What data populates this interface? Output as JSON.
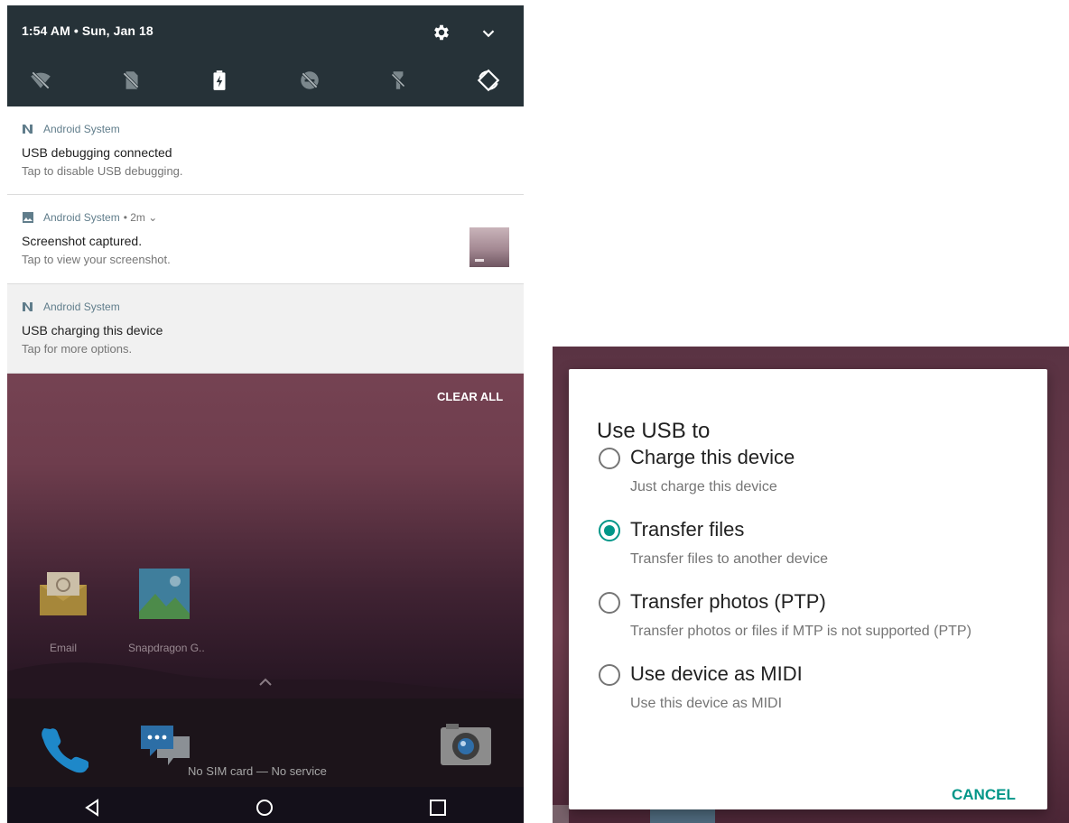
{
  "status_bar": {
    "datetime": "1:54 AM • Sun, Jan 18",
    "icons": [
      "gear-icon",
      "chevron-down-icon"
    ]
  },
  "quick_settings": {
    "tiles": [
      "wifi-off-icon",
      "no-sim-icon",
      "battery-charging-icon",
      "dnd-off-icon",
      "flashlight-off-icon",
      "auto-rotate-icon"
    ]
  },
  "notifications": [
    {
      "app": "Android System",
      "meta": "",
      "title": "USB debugging connected",
      "text": "Tap to disable USB debugging."
    },
    {
      "app": "Android System",
      "meta": "• 2m ⌄",
      "title": "Screenshot captured.",
      "text": "Tap to view your screenshot."
    },
    {
      "app": "Android System",
      "meta": "",
      "title": "USB charging this device",
      "text": "Tap for more options."
    }
  ],
  "clear_all": "CLEAR ALL",
  "home": {
    "apps": [
      {
        "label": "Email",
        "icon": "email-app-icon"
      },
      {
        "label": "Snapdragon G..",
        "icon": "gallery-app-icon"
      }
    ],
    "dock": [
      "phone-app-icon",
      "messaging-app-icon",
      "camera-app-icon"
    ],
    "status_text": "No SIM card — No service"
  },
  "nav": [
    "back-icon",
    "home-icon",
    "recents-icon"
  ],
  "usb_dialog": {
    "title": "Use USB to",
    "options": [
      {
        "label": "Charge this device",
        "sub": "Just charge this device",
        "selected": false
      },
      {
        "label": "Transfer files",
        "sub": "Transfer files to another device",
        "selected": true
      },
      {
        "label": "Transfer photos (PTP)",
        "sub": "Transfer photos or files if MTP is not supported (PTP)",
        "selected": false
      },
      {
        "label": "Use device as MIDI",
        "sub": "Use this device as MIDI",
        "selected": false
      }
    ],
    "cancel": "CANCEL"
  },
  "colors": {
    "status_panel": "#263238",
    "accent": "#009688",
    "app_name": "#607d8b",
    "wallpaper": "#6e3d4d"
  }
}
